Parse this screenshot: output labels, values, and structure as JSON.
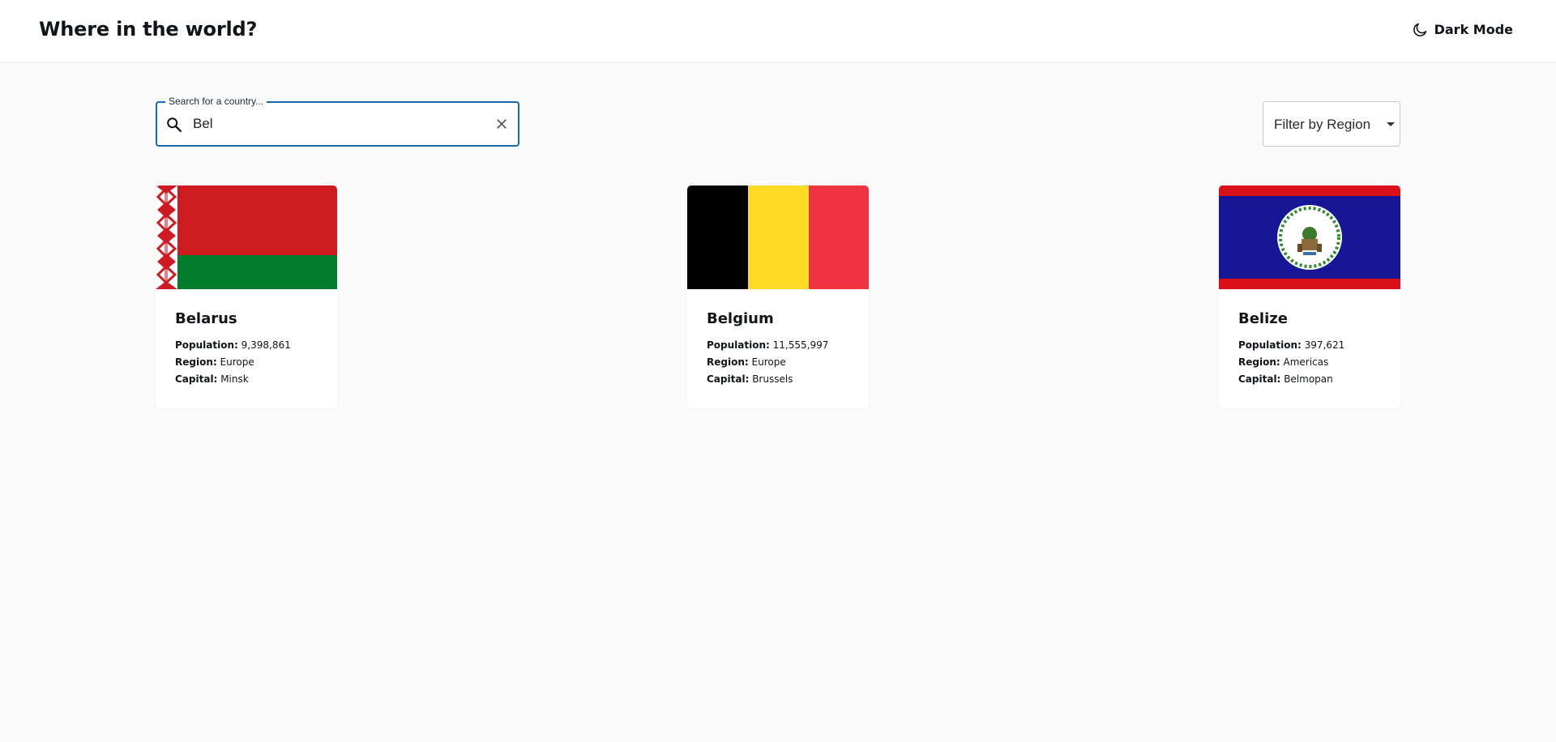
{
  "header": {
    "title": "Where in the world?",
    "dark_mode_label": "Dark Mode"
  },
  "search": {
    "label": "Search for a country...",
    "value": "Bel"
  },
  "filter": {
    "label": "Filter by Region"
  },
  "field_labels": {
    "population": "Population:",
    "region": "Region:",
    "capital": "Capital:"
  },
  "countries": [
    {
      "name": "Belarus",
      "population": "9,398,861",
      "region": "Europe",
      "capital": "Minsk",
      "flag": "belarus-flag"
    },
    {
      "name": "Belgium",
      "population": "11,555,997",
      "region": "Europe",
      "capital": "Brussels",
      "flag": "belgium-flag"
    },
    {
      "name": "Belize",
      "population": "397,621",
      "region": "Americas",
      "capital": "Belmopan",
      "flag": "belize-flag"
    }
  ],
  "colors": {
    "accent": "#1769aa",
    "background": "#fafafa"
  }
}
